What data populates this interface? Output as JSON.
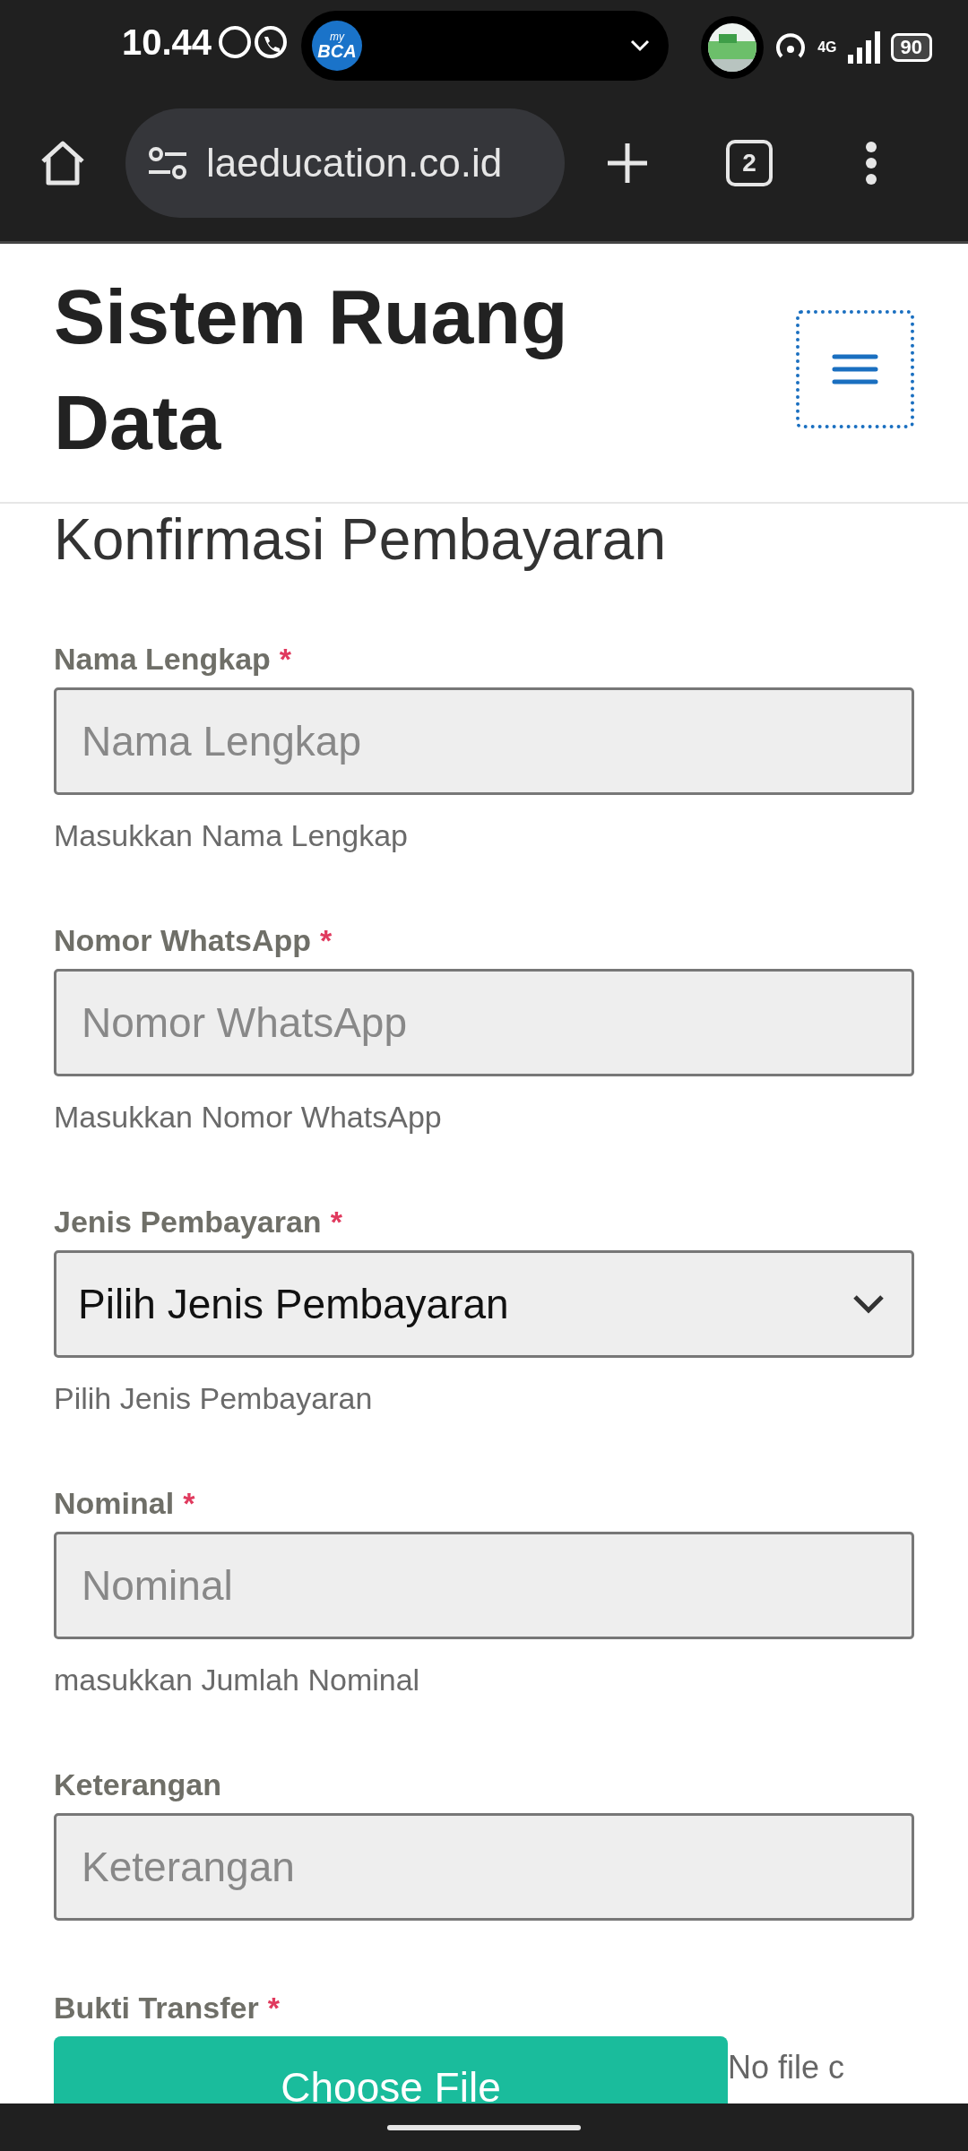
{
  "status_bar": {
    "time": "10.44",
    "app_badge_top": "my",
    "app_badge_main": "BCA",
    "network": "4G",
    "battery": "90"
  },
  "browser": {
    "url": "laeducation.co.id",
    "tab_count": "2"
  },
  "header": {
    "title": "Sistem Ruang Data"
  },
  "page_title": "Konfirmasi Pembayaran",
  "fields": [
    {
      "kind": "text",
      "label": "Nama Lengkap",
      "required_mark": "*",
      "placeholder": "Nama Lengkap",
      "help": "Masukkan Nama Lengkap"
    },
    {
      "kind": "text",
      "label": "Nomor WhatsApp",
      "required_mark": "*",
      "placeholder": "Nomor WhatsApp",
      "help": "Masukkan Nomor WhatsApp"
    },
    {
      "kind": "select",
      "label": "Jenis Pembayaran",
      "required_mark": "*",
      "value": "Pilih Jenis Pembayaran",
      "help": "Pilih Jenis Pembayaran"
    },
    {
      "kind": "text",
      "label": "Nominal",
      "required_mark": "*",
      "placeholder": "Nominal",
      "help": "masukkan Jumlah Nominal"
    },
    {
      "kind": "text",
      "label": "Keterangan",
      "placeholder": "Keterangan"
    },
    {
      "kind": "file",
      "label": "Bukti Transfer",
      "required_mark": "*",
      "button": "Choose File",
      "status": "No file c"
    }
  ]
}
